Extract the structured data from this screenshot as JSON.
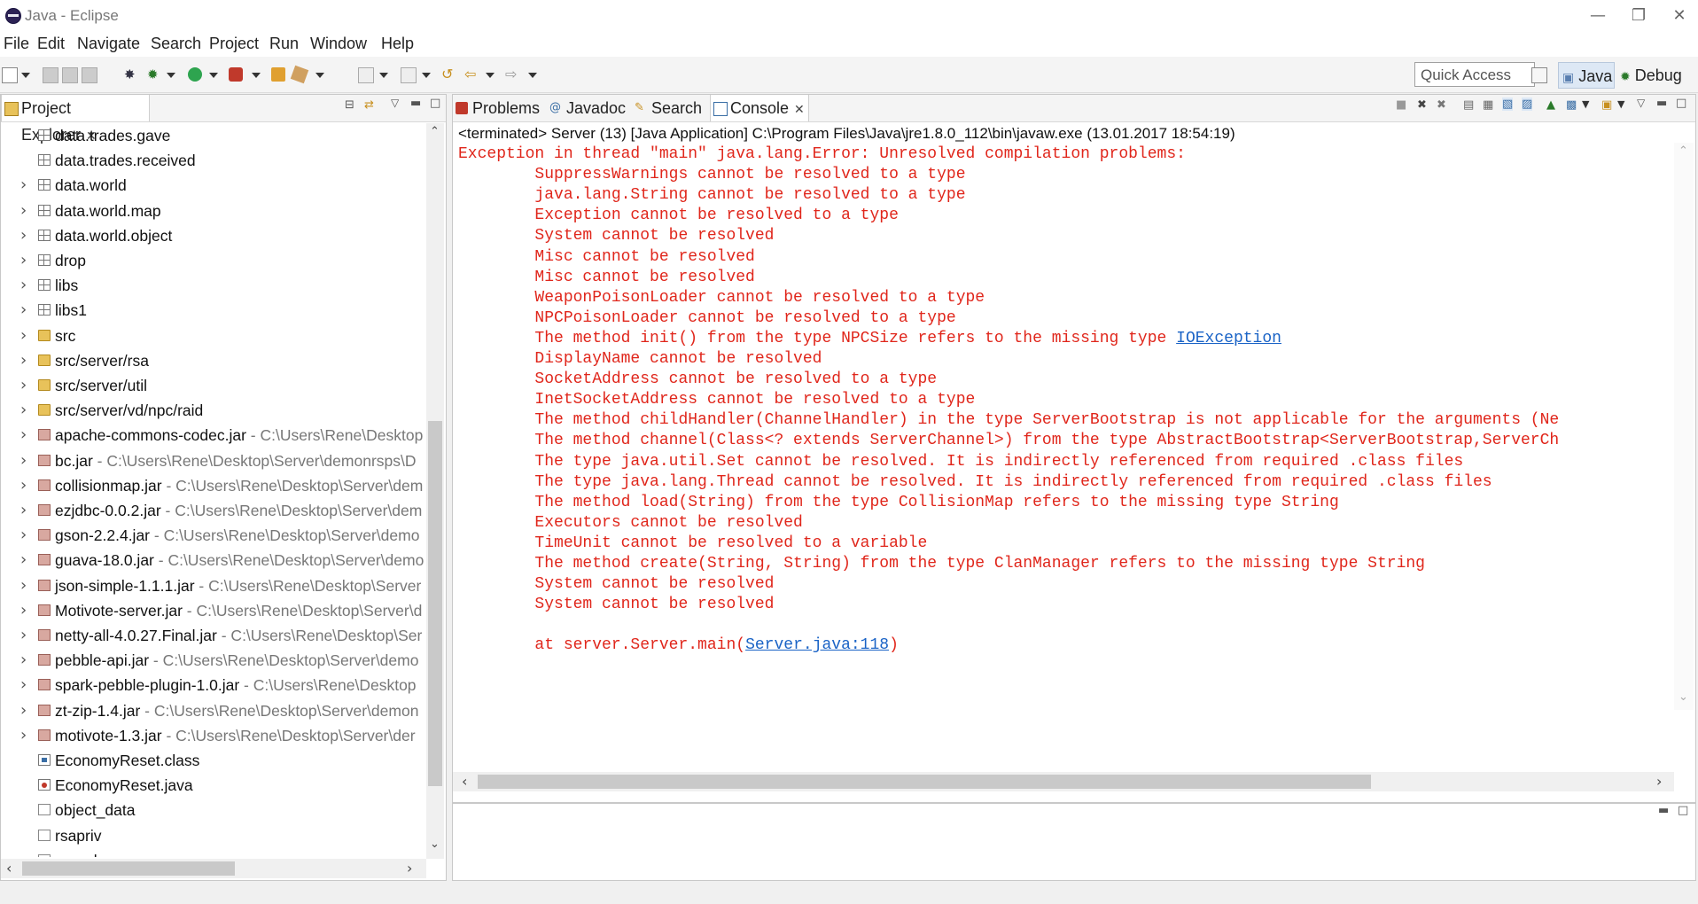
{
  "window": {
    "title": "Java - Eclipse"
  },
  "menu": [
    "File",
    "Edit",
    "Navigate",
    "Search",
    "Project",
    "Run",
    "Window",
    "Help"
  ],
  "toolbar": {
    "quick_access": "Quick Access",
    "perspectives": [
      "Java",
      "Debug"
    ]
  },
  "project_explorer": {
    "tab_label": "Project Explorer",
    "items": [
      {
        "label": "data.trades.gave",
        "path": "",
        "icon": "package-icon",
        "expand": false
      },
      {
        "label": "data.trades.received",
        "path": "",
        "icon": "package-icon",
        "expand": false
      },
      {
        "label": "data.world",
        "path": "",
        "icon": "package-icon",
        "expand": true
      },
      {
        "label": "data.world.map",
        "path": "",
        "icon": "package-icon",
        "expand": true
      },
      {
        "label": "data.world.object",
        "path": "",
        "icon": "package-icon",
        "expand": true
      },
      {
        "label": "drop",
        "path": "",
        "icon": "package-icon",
        "expand": true
      },
      {
        "label": "libs",
        "path": "",
        "icon": "package-icon",
        "expand": true
      },
      {
        "label": "libs1",
        "path": "",
        "icon": "package-icon",
        "expand": true
      },
      {
        "label": "src",
        "path": "",
        "icon": "source-folder-icon",
        "expand": true
      },
      {
        "label": "src/server/rsa",
        "path": "",
        "icon": "source-folder-icon",
        "expand": true
      },
      {
        "label": "src/server/util",
        "path": "",
        "icon": "source-folder-icon",
        "expand": true
      },
      {
        "label": "src/server/vd/npc/raid",
        "path": "",
        "icon": "source-folder-icon",
        "expand": true
      },
      {
        "label": "apache-commons-codec.jar",
        "path": " - C:\\Users\\Rene\\Desktop",
        "icon": "jar-icon",
        "expand": true
      },
      {
        "label": "bc.jar",
        "path": " - C:\\Users\\Rene\\Desktop\\Server\\demonrsps\\D",
        "icon": "jar-icon",
        "expand": true
      },
      {
        "label": "collisionmap.jar",
        "path": " - C:\\Users\\Rene\\Desktop\\Server\\dem",
        "icon": "jar-icon",
        "expand": true
      },
      {
        "label": "ezjdbc-0.0.2.jar",
        "path": " - C:\\Users\\Rene\\Desktop\\Server\\dem",
        "icon": "jar-icon",
        "expand": true
      },
      {
        "label": "gson-2.2.4.jar",
        "path": " - C:\\Users\\Rene\\Desktop\\Server\\demo",
        "icon": "jar-icon",
        "expand": true
      },
      {
        "label": "guava-18.0.jar",
        "path": " - C:\\Users\\Rene\\Desktop\\Server\\demo",
        "icon": "jar-icon",
        "expand": true
      },
      {
        "label": "json-simple-1.1.1.jar",
        "path": " - C:\\Users\\Rene\\Desktop\\Server",
        "icon": "jar-icon",
        "expand": true
      },
      {
        "label": "Motivote-server.jar",
        "path": " - C:\\Users\\Rene\\Desktop\\Server\\d",
        "icon": "jar-icon",
        "expand": true
      },
      {
        "label": "netty-all-4.0.27.Final.jar",
        "path": " - C:\\Users\\Rene\\Desktop\\Ser",
        "icon": "jar-icon",
        "expand": true
      },
      {
        "label": "pebble-api.jar",
        "path": " - C:\\Users\\Rene\\Desktop\\Server\\demo",
        "icon": "jar-icon",
        "expand": true
      },
      {
        "label": "spark-pebble-plugin-1.0.jar",
        "path": " - C:\\Users\\Rene\\Desktop",
        "icon": "jar-icon",
        "expand": true
      },
      {
        "label": "zt-zip-1.4.jar",
        "path": " - C:\\Users\\Rene\\Desktop\\Server\\demon",
        "icon": "jar-icon",
        "expand": true
      },
      {
        "label": "motivote-1.3.jar",
        "path": " - C:\\Users\\Rene\\Desktop\\Server\\der",
        "icon": "jar-icon",
        "expand": true
      },
      {
        "label": "EconomyReset.class",
        "path": "",
        "icon": "class-file-icon",
        "expand": false
      },
      {
        "label": "EconomyReset.java",
        "path": "",
        "icon": "java-file-icon",
        "expand": false
      },
      {
        "label": "object_data",
        "path": "",
        "icon": "file-icon",
        "expand": false
      },
      {
        "label": "rsapriv",
        "path": "",
        "icon": "file-icon",
        "expand": false
      },
      {
        "label": "rsapub",
        "path": "",
        "icon": "file-icon",
        "expand": false
      }
    ]
  },
  "editor_tabs": [
    "Problems",
    "Javadoc",
    "Search",
    "Console"
  ],
  "console": {
    "header": "<terminated> Server (13) [Java Application] C:\\Program Files\\Java\\jre1.8.0_112\\bin\\javaw.exe (13.01.2017 18:54:19)",
    "lines": [
      "Exception in thread \"main\" java.lang.Error: Unresolved compilation problems: ",
      "\tSuppressWarnings cannot be resolved to a type",
      "\tjava.lang.String cannot be resolved to a type",
      "\tException cannot be resolved to a type",
      "\tSystem cannot be resolved",
      "\tMisc cannot be resolved",
      "\tMisc cannot be resolved",
      "\tWeaponPoisonLoader cannot be resolved to a type",
      "\tNPCPoisonLoader cannot be resolved to a type",
      "\tThe method init() from the type NPCSize refers to the missing type ",
      "\tDisplayName cannot be resolved",
      "\tSocketAddress cannot be resolved to a type",
      "\tInetSocketAddress cannot be resolved to a type",
      "\tThe method childHandler(ChannelHandler) in the type ServerBootstrap is not applicable for the arguments (Ne",
      "\tThe method channel(Class<? extends ServerChannel>) from the type AbstractBootstrap<ServerBootstrap,ServerCh",
      "\tThe type java.util.Set cannot be resolved. It is indirectly referenced from required .class files",
      "\tThe type java.lang.Thread cannot be resolved. It is indirectly referenced from required .class files",
      "\tThe method load(String) from the type CollisionMap refers to the missing type String",
      "\tExecutors cannot be resolved",
      "\tTimeUnit cannot be resolved to a variable",
      "\tThe method create(String, String) from the type ClanManager refers to the missing type String",
      "\tSystem cannot be resolved",
      "\tSystem cannot be resolved",
      "",
      "\tat server.Server.main("
    ],
    "link_ioexception": "IOException",
    "link_server_java": "Server.java:118",
    "trailing_paren": ")"
  }
}
